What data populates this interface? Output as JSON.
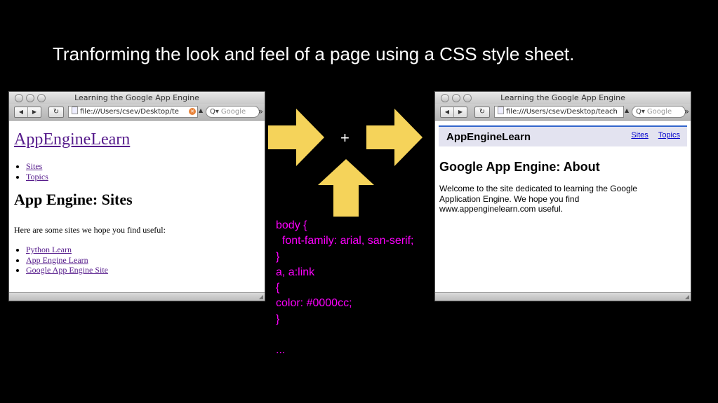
{
  "slide": {
    "title": "Tranforming the look and feel of a page using a CSS style sheet."
  },
  "plus_sign": "+",
  "browser_left": {
    "window_title": "Learning the Google App Engine",
    "url": "file:///Users/csev/Desktop/te",
    "search_placeholder": "Google",
    "page": {
      "site_link": "AppEngineLearn",
      "nav_items": [
        "Sites",
        "Topics"
      ],
      "heading": "App Engine: Sites",
      "intro": "Here are some sites we hope you find useful:",
      "site_links": [
        "Python Learn",
        "App Engine Learn",
        "Google App Engine Site"
      ]
    }
  },
  "browser_right": {
    "window_title": "Learning the Google App Engine",
    "url": "file:///Users/csev/Desktop/teach",
    "search_placeholder": "Google",
    "page": {
      "brand": "AppEngineLearn",
      "nav_items": [
        "Sites",
        "Topics"
      ],
      "heading": "Google App Engine: About",
      "body": "Welcome to the site dedicated to learning the Google Application Engine. We hope you find www.appenginelearn.com useful."
    }
  },
  "css_code": {
    "lines": [
      "body {",
      "  font-family: arial, san-serif;",
      "}",
      "a, a:link",
      "{",
      "color: #0000cc;",
      "}",
      "",
      "..."
    ]
  },
  "colors": {
    "background": "#000000",
    "arrow_fill": "#f5d35a",
    "code_text": "#ff00ff",
    "visited_link": "#551a8b",
    "styled_link": "#0000cc",
    "header_band": "#e3e3f0",
    "header_rule": "#3366cc"
  }
}
